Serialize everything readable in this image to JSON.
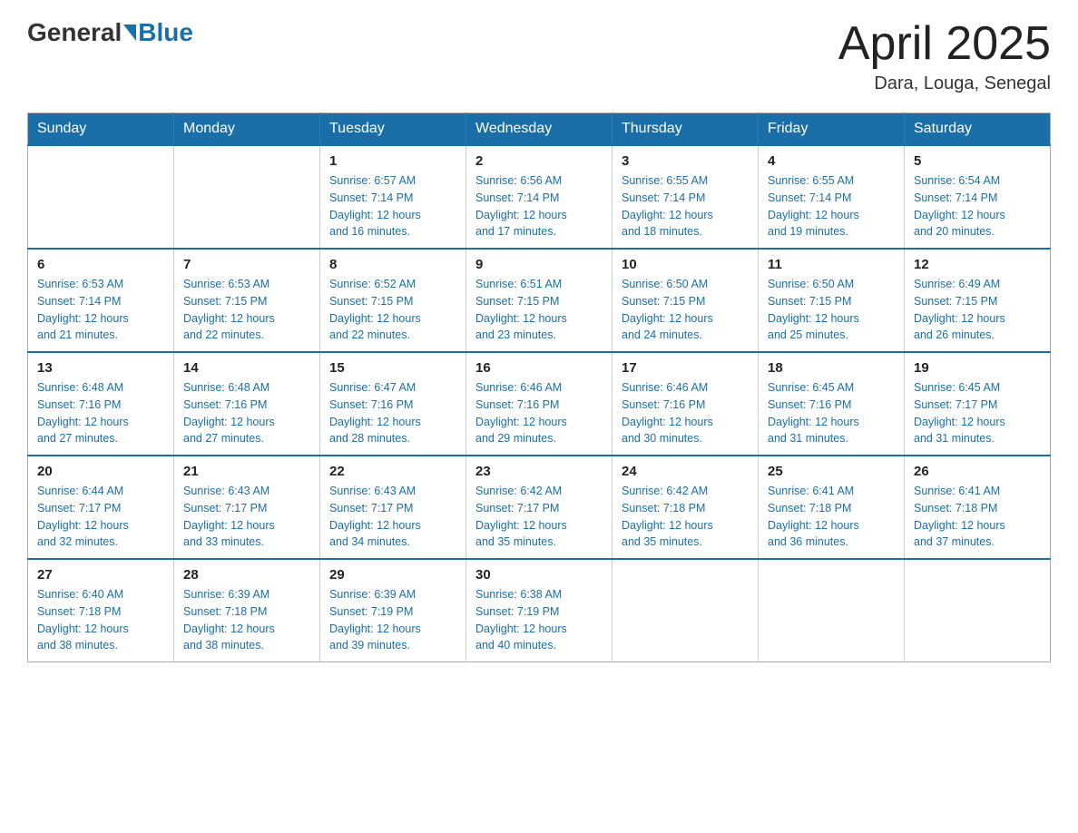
{
  "header": {
    "logo_general": "General",
    "logo_blue": "Blue",
    "month_title": "April 2025",
    "location": "Dara, Louga, Senegal"
  },
  "weekdays": [
    "Sunday",
    "Monday",
    "Tuesday",
    "Wednesday",
    "Thursday",
    "Friday",
    "Saturday"
  ],
  "weeks": [
    [
      {
        "day": "",
        "info": ""
      },
      {
        "day": "",
        "info": ""
      },
      {
        "day": "1",
        "info": "Sunrise: 6:57 AM\nSunset: 7:14 PM\nDaylight: 12 hours\nand 16 minutes."
      },
      {
        "day": "2",
        "info": "Sunrise: 6:56 AM\nSunset: 7:14 PM\nDaylight: 12 hours\nand 17 minutes."
      },
      {
        "day": "3",
        "info": "Sunrise: 6:55 AM\nSunset: 7:14 PM\nDaylight: 12 hours\nand 18 minutes."
      },
      {
        "day": "4",
        "info": "Sunrise: 6:55 AM\nSunset: 7:14 PM\nDaylight: 12 hours\nand 19 minutes."
      },
      {
        "day": "5",
        "info": "Sunrise: 6:54 AM\nSunset: 7:14 PM\nDaylight: 12 hours\nand 20 minutes."
      }
    ],
    [
      {
        "day": "6",
        "info": "Sunrise: 6:53 AM\nSunset: 7:14 PM\nDaylight: 12 hours\nand 21 minutes."
      },
      {
        "day": "7",
        "info": "Sunrise: 6:53 AM\nSunset: 7:15 PM\nDaylight: 12 hours\nand 22 minutes."
      },
      {
        "day": "8",
        "info": "Sunrise: 6:52 AM\nSunset: 7:15 PM\nDaylight: 12 hours\nand 22 minutes."
      },
      {
        "day": "9",
        "info": "Sunrise: 6:51 AM\nSunset: 7:15 PM\nDaylight: 12 hours\nand 23 minutes."
      },
      {
        "day": "10",
        "info": "Sunrise: 6:50 AM\nSunset: 7:15 PM\nDaylight: 12 hours\nand 24 minutes."
      },
      {
        "day": "11",
        "info": "Sunrise: 6:50 AM\nSunset: 7:15 PM\nDaylight: 12 hours\nand 25 minutes."
      },
      {
        "day": "12",
        "info": "Sunrise: 6:49 AM\nSunset: 7:15 PM\nDaylight: 12 hours\nand 26 minutes."
      }
    ],
    [
      {
        "day": "13",
        "info": "Sunrise: 6:48 AM\nSunset: 7:16 PM\nDaylight: 12 hours\nand 27 minutes."
      },
      {
        "day": "14",
        "info": "Sunrise: 6:48 AM\nSunset: 7:16 PM\nDaylight: 12 hours\nand 27 minutes."
      },
      {
        "day": "15",
        "info": "Sunrise: 6:47 AM\nSunset: 7:16 PM\nDaylight: 12 hours\nand 28 minutes."
      },
      {
        "day": "16",
        "info": "Sunrise: 6:46 AM\nSunset: 7:16 PM\nDaylight: 12 hours\nand 29 minutes."
      },
      {
        "day": "17",
        "info": "Sunrise: 6:46 AM\nSunset: 7:16 PM\nDaylight: 12 hours\nand 30 minutes."
      },
      {
        "day": "18",
        "info": "Sunrise: 6:45 AM\nSunset: 7:16 PM\nDaylight: 12 hours\nand 31 minutes."
      },
      {
        "day": "19",
        "info": "Sunrise: 6:45 AM\nSunset: 7:17 PM\nDaylight: 12 hours\nand 31 minutes."
      }
    ],
    [
      {
        "day": "20",
        "info": "Sunrise: 6:44 AM\nSunset: 7:17 PM\nDaylight: 12 hours\nand 32 minutes."
      },
      {
        "day": "21",
        "info": "Sunrise: 6:43 AM\nSunset: 7:17 PM\nDaylight: 12 hours\nand 33 minutes."
      },
      {
        "day": "22",
        "info": "Sunrise: 6:43 AM\nSunset: 7:17 PM\nDaylight: 12 hours\nand 34 minutes."
      },
      {
        "day": "23",
        "info": "Sunrise: 6:42 AM\nSunset: 7:17 PM\nDaylight: 12 hours\nand 35 minutes."
      },
      {
        "day": "24",
        "info": "Sunrise: 6:42 AM\nSunset: 7:18 PM\nDaylight: 12 hours\nand 35 minutes."
      },
      {
        "day": "25",
        "info": "Sunrise: 6:41 AM\nSunset: 7:18 PM\nDaylight: 12 hours\nand 36 minutes."
      },
      {
        "day": "26",
        "info": "Sunrise: 6:41 AM\nSunset: 7:18 PM\nDaylight: 12 hours\nand 37 minutes."
      }
    ],
    [
      {
        "day": "27",
        "info": "Sunrise: 6:40 AM\nSunset: 7:18 PM\nDaylight: 12 hours\nand 38 minutes."
      },
      {
        "day": "28",
        "info": "Sunrise: 6:39 AM\nSunset: 7:18 PM\nDaylight: 12 hours\nand 38 minutes."
      },
      {
        "day": "29",
        "info": "Sunrise: 6:39 AM\nSunset: 7:19 PM\nDaylight: 12 hours\nand 39 minutes."
      },
      {
        "day": "30",
        "info": "Sunrise: 6:38 AM\nSunset: 7:19 PM\nDaylight: 12 hours\nand 40 minutes."
      },
      {
        "day": "",
        "info": ""
      },
      {
        "day": "",
        "info": ""
      },
      {
        "day": "",
        "info": ""
      }
    ]
  ]
}
